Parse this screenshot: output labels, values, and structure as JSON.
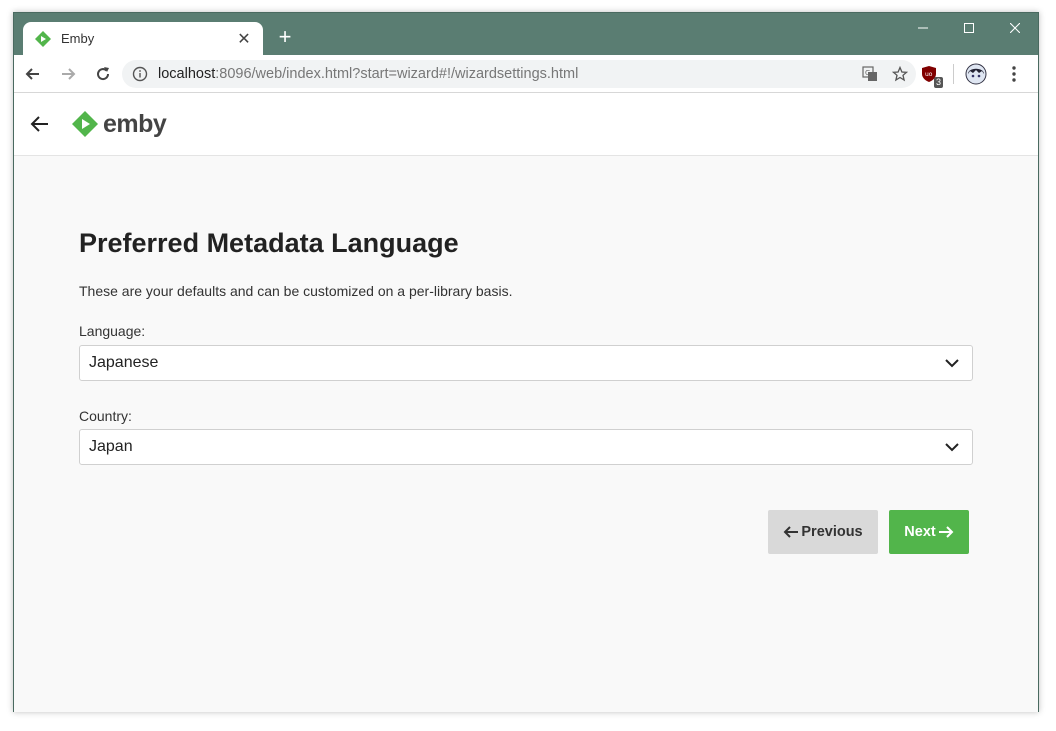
{
  "browser": {
    "tab_title": "Emby",
    "tab_close": "✕",
    "new_tab": "+",
    "url_host": "localhost",
    "url_rest": ":8096/web/index.html?start=wizard#!/wizardsettings.html",
    "extension_badge": "3",
    "controls": {
      "minimize": "—",
      "maximize": "☐",
      "close": "✕"
    }
  },
  "app": {
    "logo_text": "emby",
    "brand_color": "#52b54b"
  },
  "wizard": {
    "title": "Preferred Metadata Language",
    "description": "These are your defaults and can be customized on a per-library basis.",
    "language_label": "Language:",
    "language_value": "Japanese",
    "country_label": "Country:",
    "country_value": "Japan",
    "previous_label": "Previous",
    "next_label": "Next"
  },
  "icons": [
    "emby-favicon-icon",
    "back-arrow-icon",
    "forward-arrow-icon",
    "reload-icon",
    "info-icon",
    "translate-icon",
    "star-icon",
    "ublock-icon",
    "profile-avatar-icon",
    "menu-dots-icon",
    "chevron-down-icon",
    "arrow-left-icon",
    "arrow-right-icon"
  ]
}
